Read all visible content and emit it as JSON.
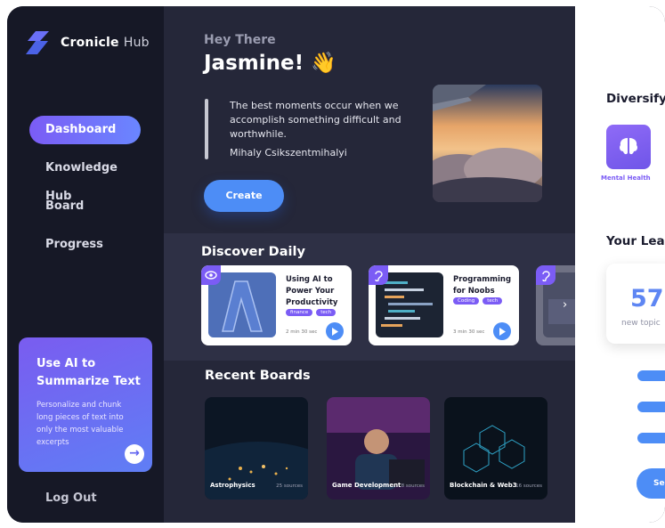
{
  "app": {
    "brand_main": "Cronicle",
    "brand_sub": "Hub"
  },
  "nav": [
    "Dashboard",
    "Knowledge Hub",
    "Board",
    "Progress"
  ],
  "promo": {
    "title": "Use AI to Summarize Text",
    "description": "Personalize and chunk long pieces of text into only the most valuable excerpts"
  },
  "logout_label": "Log Out",
  "greeting": {
    "small": "Hey There",
    "name": "Jasmine! 👋"
  },
  "quote": {
    "text": "The best moments occur when  we accomplish something difficult and worthwhile.",
    "author": "Mihaly Csikszentmihalyi"
  },
  "create_label": "Create",
  "discover": {
    "title": "Discover Daily",
    "cards": [
      {
        "title": "Using AI to Power Your Productivity",
        "tags": [
          "finance",
          "tech"
        ],
        "duration": "2 min 30 sec",
        "badge_icon": "eye-icon"
      },
      {
        "title": "Programming for Noobs",
        "tags": [
          "Coding",
          "tech"
        ],
        "duration": "3 min 30 sec",
        "badge_icon": "ear-icon"
      }
    ]
  },
  "recent": {
    "title": "Recent Boards",
    "boards": [
      {
        "name": "Astrophysics",
        "sources": "25 sources"
      },
      {
        "name": "Game Development",
        "sources": "8 sources"
      },
      {
        "name": "Blockchain & Web3",
        "sources": "16 sources"
      }
    ]
  },
  "right": {
    "diversify_title": "Diversify",
    "category_label": "Mental Health",
    "learning_title": "Your Lear",
    "topics_count": "57",
    "topics_label": "new topic",
    "button_label": "Se",
    "stats_icons": [
      "brain-icon",
      "dumbbell-icon",
      "dollar-icon"
    ]
  },
  "colors": {
    "accent": "#7b5cf5",
    "blue": "#4d8df6",
    "sidebar": "#161826",
    "main": "#252739"
  }
}
